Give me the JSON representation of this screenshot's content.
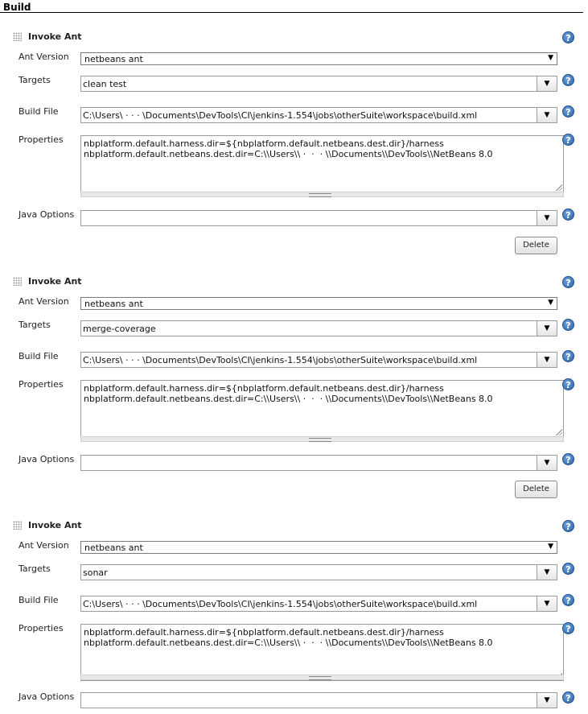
{
  "section": {
    "title": "Build"
  },
  "labels": {
    "ant_version": "Ant Version",
    "targets": "Targets",
    "build_file": "Build File",
    "properties": "Properties",
    "java_options": "Java Options",
    "delete": "Delete",
    "help": "?"
  },
  "steps": [
    {
      "title": "Invoke Ant",
      "ant_version": "netbeans ant",
      "targets": "clean test",
      "build_file": "C:\\Users\\ ‧  ‧  ‧ \\Documents\\DevTools\\CI\\jenkins-1.554\\jobs\\otherSuite\\workspace\\build.xml",
      "properties": "nbplatform.default.harness.dir=${nbplatform.default.netbeans.dest.dir}/harness\nnbplatform.default.netbeans.dest.dir=C:\\\\Users\\\\ ‧  ‧  ‧ \\\\Documents\\\\DevTools\\\\NetBeans 8.0",
      "java_options": ""
    },
    {
      "title": "Invoke Ant",
      "ant_version": "netbeans ant",
      "targets": "merge-coverage",
      "build_file": "C:\\Users\\ ‧  ‧  ‧ \\Documents\\DevTools\\CI\\jenkins-1.554\\jobs\\otherSuite\\workspace\\build.xml",
      "properties": "nbplatform.default.harness.dir=${nbplatform.default.netbeans.dest.dir}/harness\nnbplatform.default.netbeans.dest.dir=C:\\\\Users\\\\ ‧  ‧  ‧ \\\\Documents\\\\DevTools\\\\NetBeans 8.0",
      "java_options": ""
    },
    {
      "title": "Invoke Ant",
      "ant_version": "netbeans ant",
      "targets": "sonar",
      "build_file": "C:\\Users\\ ‧  ‧  ‧ \\Documents\\DevTools\\CI\\jenkins-1.554\\jobs\\otherSuite\\workspace\\build.xml",
      "properties": "nbplatform.default.harness.dir=${nbplatform.default.netbeans.dest.dir}/harness\nnbplatform.default.netbeans.dest.dir=C:\\\\Users\\\\ ‧  ‧  ‧ \\\\Documents\\\\DevTools\\\\NetBeans 8.0",
      "java_options": ""
    }
  ],
  "icons": {
    "select_arrow": "▼",
    "grip": "drag-handle-icon",
    "help": "help-icon"
  },
  "colors": {
    "help_blue": "#2a62a8",
    "border": "#9a9a9a"
  }
}
